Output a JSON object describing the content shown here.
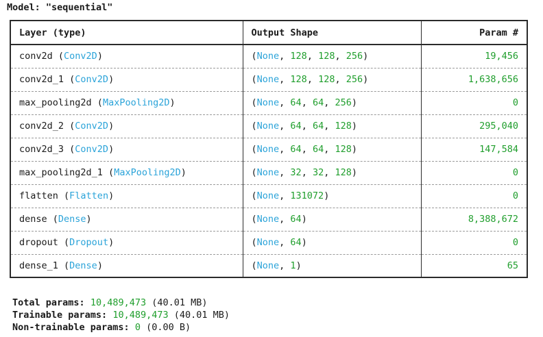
{
  "model": {
    "title": "Model: \"sequential\""
  },
  "table": {
    "headers": {
      "layer": "Layer (type)",
      "output": "Output Shape",
      "params": "Param #"
    },
    "rows": [
      {
        "name": "conv2d",
        "type": "Conv2D",
        "shape_none": "None",
        "shape_rest": ", 128, 128, 256",
        "params": "19,456"
      },
      {
        "name": "conv2d_1",
        "type": "Conv2D",
        "shape_none": "None",
        "shape_rest": ", 128, 128, 256",
        "params": "1,638,656"
      },
      {
        "name": "max_pooling2d",
        "type": "MaxPooling2D",
        "shape_none": "None",
        "shape_rest": ", 64, 64, 256",
        "params": "0"
      },
      {
        "name": "conv2d_2",
        "type": "Conv2D",
        "shape_none": "None",
        "shape_rest": ", 64, 64, 128",
        "params": "295,040"
      },
      {
        "name": "conv2d_3",
        "type": "Conv2D",
        "shape_none": "None",
        "shape_rest": ", 64, 64, 128",
        "params": "147,584"
      },
      {
        "name": "max_pooling2d_1",
        "type": "MaxPooling2D",
        "shape_none": "None",
        "shape_rest": ", 32, 32, 128",
        "params": "0"
      },
      {
        "name": "flatten",
        "type": "Flatten",
        "shape_none": "None",
        "shape_rest": ", 131072",
        "params": "0"
      },
      {
        "name": "dense",
        "type": "Dense",
        "shape_none": "None",
        "shape_rest": ", 64",
        "params": "8,388,672"
      },
      {
        "name": "dropout",
        "type": "Dropout",
        "shape_none": "None",
        "shape_rest": ", 64",
        "params": "0"
      },
      {
        "name": "dense_1",
        "type": "Dense",
        "shape_none": "None",
        "shape_rest": ", 1",
        "params": "65"
      }
    ]
  },
  "summary": {
    "total": {
      "label": "Total params:",
      "value": "10,489,473",
      "size": "(40.01 MB)"
    },
    "trainable": {
      "label": "Trainable params:",
      "value": "10,489,473",
      "size": "(40.01 MB)"
    },
    "non_trainable": {
      "label": "Non-trainable params:",
      "value": "0",
      "size": "(0.00 B)"
    }
  },
  "colors": {
    "type_name": "#2aa3d9",
    "numeric": "#1f9e2c",
    "border": "#2a2a2a",
    "row_divider": "#9a9a9a"
  }
}
